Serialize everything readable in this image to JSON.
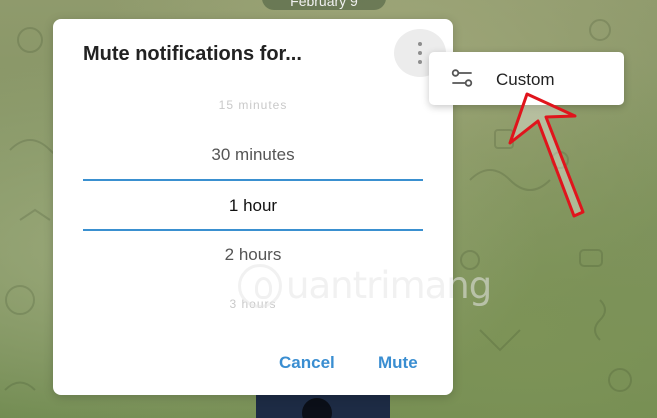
{
  "chat": {
    "date_label": "February 9"
  },
  "dialog": {
    "title": "Mute notifications for...",
    "more_icon": "vertical-ellipsis-icon",
    "options": [
      {
        "label": "15 minutes",
        "state": "faint"
      },
      {
        "label": "30 minutes",
        "state": "normal"
      },
      {
        "label": "1 hour",
        "state": "selected"
      },
      {
        "label": "2 hours",
        "state": "normal"
      },
      {
        "label": "3 hours",
        "state": "faint"
      }
    ],
    "cancel_label": "Cancel",
    "mute_label": "Mute",
    "accent_color": "#3a8ed1"
  },
  "context_menu": {
    "items": [
      {
        "label": "Custom",
        "icon": "sliders-icon"
      }
    ]
  },
  "annotation": {
    "arrow_color": "#e0141c"
  },
  "watermark": {
    "text": "uantrimang"
  }
}
